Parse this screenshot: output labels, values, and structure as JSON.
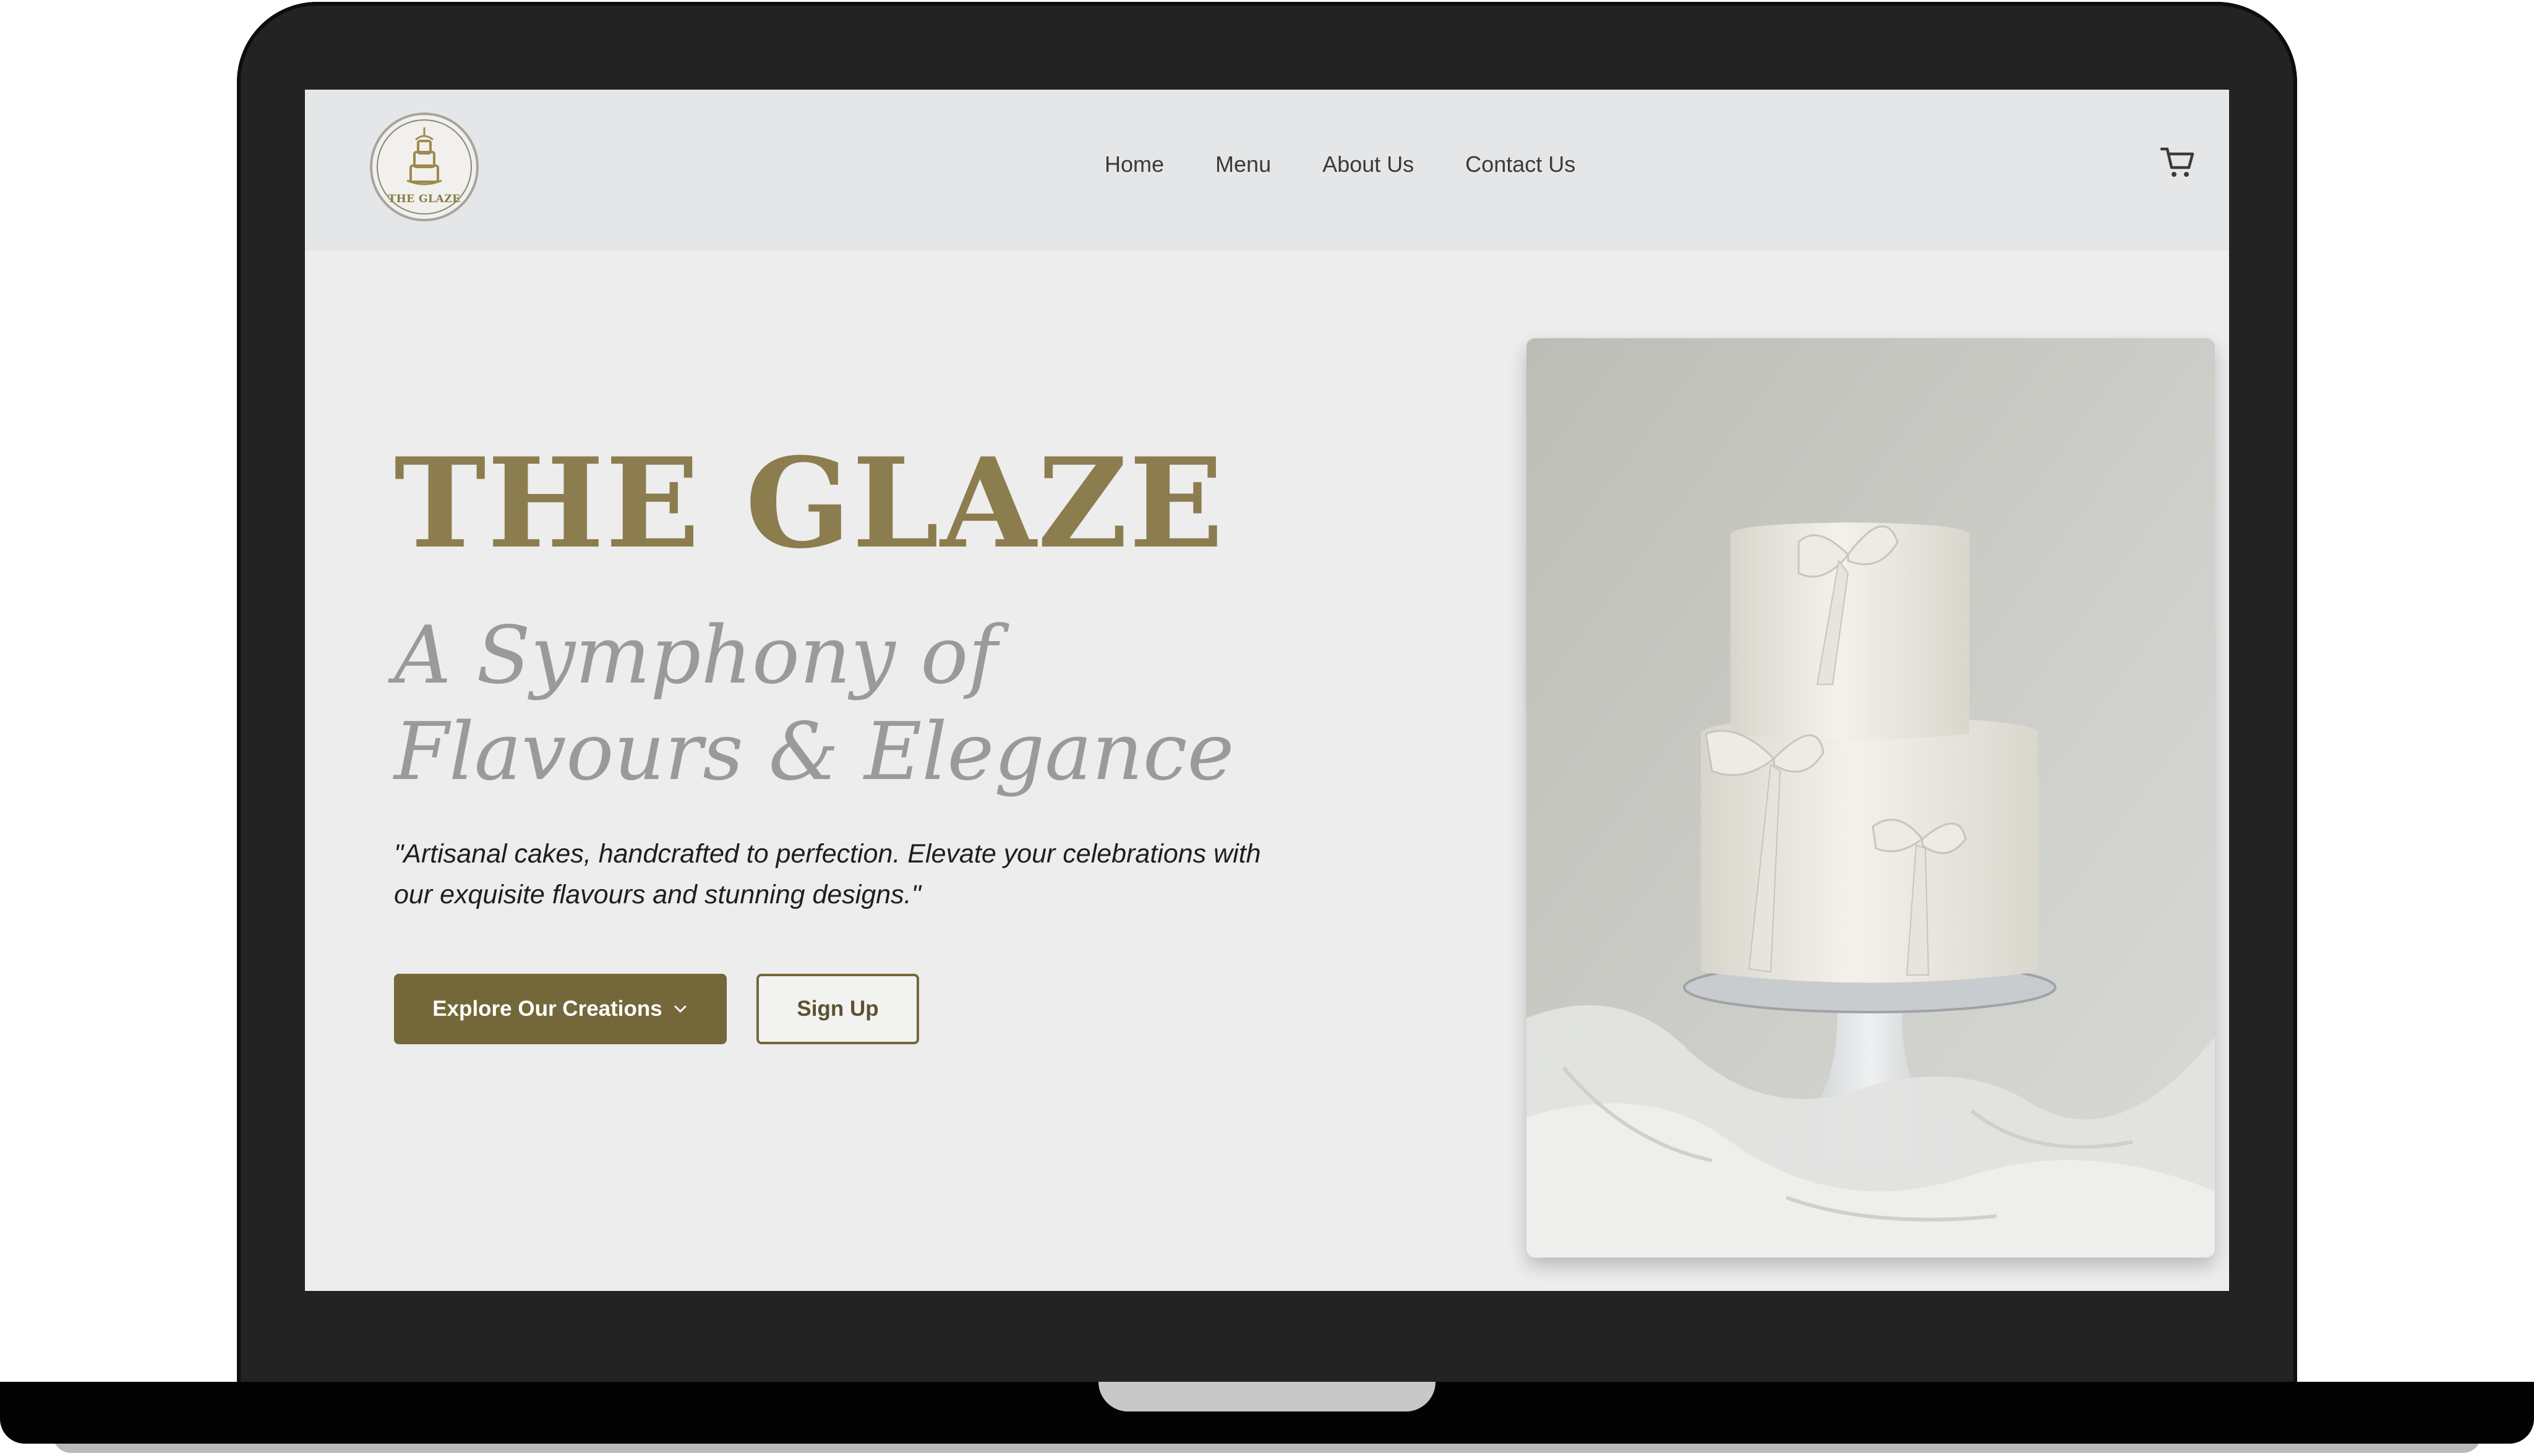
{
  "brand": {
    "logo_text": "THE GLAZE"
  },
  "nav": {
    "links": [
      "Home",
      "Menu",
      "About Us",
      "Contact Us"
    ],
    "cart_icon": "shopping-cart-icon"
  },
  "hero": {
    "title": "THE GLAZE",
    "subtitle_line1": "A Symphony of",
    "subtitle_line2": "Flavours & Elegance",
    "tagline": "\"Artisanal cakes, handcrafted to perfection. Elevate your celebrations with our exquisite flavours and stunning designs.\"",
    "primary_button": "Explore Our Creations",
    "primary_button_icon": "chevron-down-icon",
    "secondary_button": "Sign Up",
    "image_subject": "two-tier white cake with ribbon bows on a cake stand"
  },
  "colors": {
    "accent": "#746739",
    "title": "#8c7d4f",
    "subtitle": "#9a9a9a",
    "nav_bg": "#e5e6e8",
    "page_bg": "#ededee",
    "laptop_frame": "#232323"
  }
}
